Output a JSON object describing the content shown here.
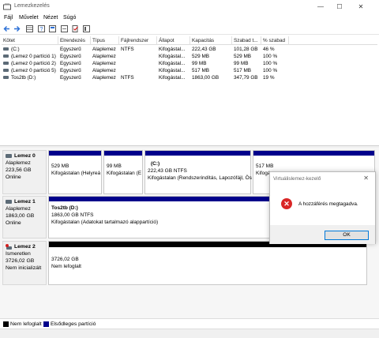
{
  "window": {
    "title": "Lemezkezelés",
    "minimize_glyph": "—",
    "maximize_glyph": "☐",
    "close_glyph": "✕"
  },
  "menu": [
    "Fájl",
    "Művelet",
    "Nézet",
    "Súgó"
  ],
  "toolbar_icons": [
    "back-icon",
    "forward-icon",
    "grid-view-icon",
    "help-icon",
    "properties-icon",
    "refresh-icon",
    "check-icon",
    "settings-icon"
  ],
  "volume_table": {
    "headers": [
      "Kötet",
      "Elrendezés",
      "Típus",
      "Fájlrendszer",
      "Állapot",
      "Kapacitás",
      "Szabad t...",
      "% szabad"
    ],
    "rows": [
      [
        "(C:)",
        "Egyszerű",
        "Alaplemez",
        "NTFS",
        "Kifogástal...",
        "222,43 GB",
        "101,28 GB",
        "46 %"
      ],
      [
        "(Lemez 0 partíció 1)",
        "Egyszerű",
        "Alaplemez",
        "",
        "Kifogástal...",
        "529 MB",
        "529 MB",
        "100 %"
      ],
      [
        "(Lemez 0 partíció 2)",
        "Egyszerű",
        "Alaplemez",
        "",
        "Kifogástal...",
        "99 MB",
        "99 MB",
        "100 %"
      ],
      [
        "(Lemez 0 partíció 5)",
        "Egyszerű",
        "Alaplemez",
        "",
        "Kifogástal...",
        "517 MB",
        "517 MB",
        "100 %"
      ],
      [
        "Tos2tb (D:)",
        "Egyszerű",
        "Alaplemez",
        "NTFS",
        "Kifogástal...",
        "1863,00 GB",
        "347,79 GB",
        "19 %"
      ]
    ]
  },
  "disks": [
    {
      "name": "Lemez 0",
      "type": "Alaplemez",
      "size": "223,56 GB",
      "status": "Online",
      "partitions": [
        {
          "label": "",
          "size": "529 MB",
          "status": "Kifogástalan (Helyreá"
        },
        {
          "label": "",
          "size": "99 MB",
          "status": "Kifogástalan (E"
        },
        {
          "label": "(C:)",
          "size": "222,43 GB NTFS",
          "status": "Kifogástalan (Rendszerindítás, Lapozófájl, Ös"
        },
        {
          "label": "",
          "size": "517 MB",
          "status": "Kifogá"
        }
      ]
    },
    {
      "name": "Lemez 1",
      "type": "Alaplemez",
      "size": "1863,00 GB",
      "status": "Online",
      "partitions": [
        {
          "label": "Tos2tb  (D:)",
          "size": "1863,00 GB NTFS",
          "status": "Kifogástalan (Adatokat tartalmazó alappartíció)"
        }
      ]
    },
    {
      "name": "Lemez 2",
      "type": "Ismeretlen",
      "size": "3726,02 GB",
      "status": "Nem inicializált",
      "partitions": [
        {
          "label": "",
          "size": "3726,02 GB",
          "status": "Nem lefoglalt"
        }
      ]
    }
  ],
  "legend": [
    {
      "label": "Nem lefoglalt",
      "color": "#000000"
    },
    {
      "label": "Elsődleges partíció",
      "color": "#00008b"
    }
  ],
  "dialog": {
    "title": "Virtuálislemez-kezelő",
    "message": "A hozzáférés megtagadva.",
    "ok_label": "OK",
    "close_glyph": "✕"
  },
  "colors": {
    "primary_partition": "#00008b",
    "unallocated": "#000000",
    "error": "#d92626"
  }
}
